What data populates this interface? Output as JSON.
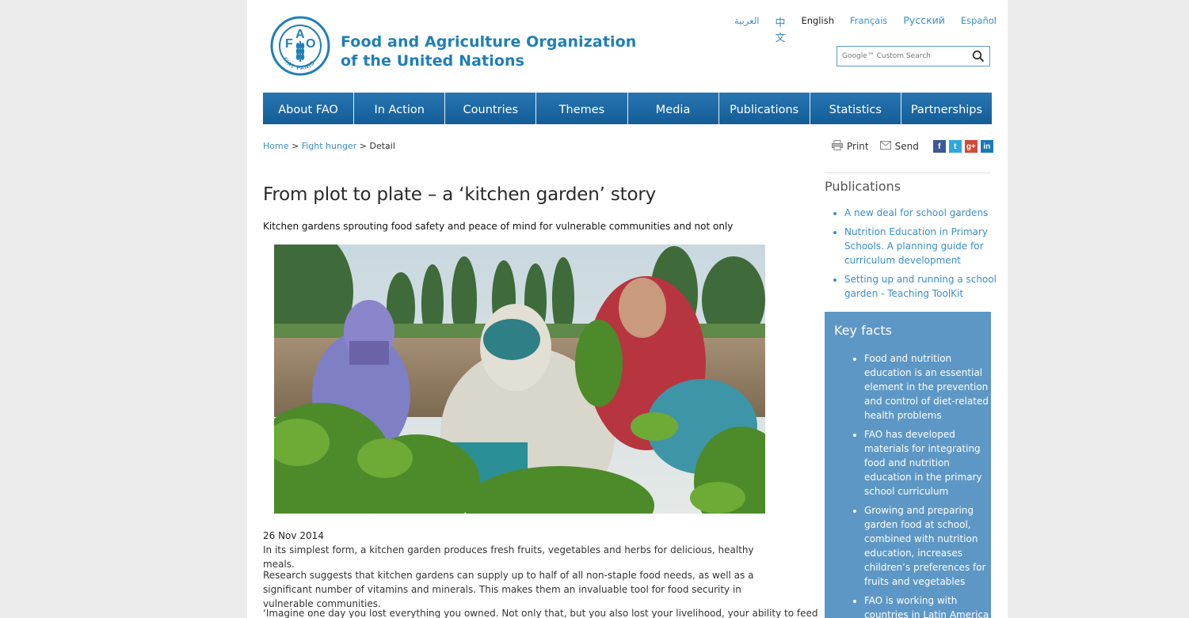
{
  "header": {
    "org_name_line1": "Food and Agriculture Organization",
    "org_name_line2": "of the United Nations",
    "logo": {
      "letters": [
        "F",
        "A",
        "O"
      ],
      "motto": "FIAT PANIS",
      "icon": "fao-logo-icon"
    }
  },
  "languages": [
    {
      "label": "العربية",
      "current": false
    },
    {
      "label": "中文",
      "current": false
    },
    {
      "label": "English",
      "current": true
    },
    {
      "label": "Français",
      "current": false
    },
    {
      "label": "Русский",
      "current": false
    },
    {
      "label": "Español",
      "current": false
    }
  ],
  "search": {
    "placeholder": "Google™ Custom Search",
    "icon": "search-icon"
  },
  "nav": [
    "About FAO",
    "In Action",
    "Countries",
    "Themes",
    "Media",
    "Publications",
    "Statistics",
    "Partnerships"
  ],
  "breadcrumb": {
    "home": "Home",
    "section": "Fight hunger",
    "current": "Detail",
    "separator": ">"
  },
  "tools": {
    "print": "Print",
    "send": "Send",
    "social": [
      {
        "name": "facebook",
        "glyph": "f",
        "color": "#3b5998"
      },
      {
        "name": "twitter",
        "glyph": "t",
        "color": "#2fa8e0"
      },
      {
        "name": "google-plus",
        "glyph": "g+",
        "color": "#d34836"
      },
      {
        "name": "linkedin",
        "glyph": "in",
        "color": "#1a7ab5"
      }
    ]
  },
  "article": {
    "title": "From plot to plate – a ‘kitchen garden’ story",
    "subtitle": "Kitchen gardens sprouting food safety and peace of mind for vulnerable communities and not only",
    "date": "26 Nov 2014",
    "paragraphs": [
      "In its simplest form, a kitchen garden produces fresh fruits, vegetables and herbs for delicious, healthy meals.",
      "Research suggests that kitchen gardens can supply up to half of all non-staple food needs, as well as a significant number of vitamins and minerals. This makes them an invaluable tool for food security in vulnerable communities.",
      "‘Imagine one day you lost everything you owned.  Not only that, but you also lost your livelihood, your ability to feed"
    ]
  },
  "sidebar": {
    "publications_heading": "Publications",
    "publications": [
      "A new deal for school gardens",
      "Nutrition Education in Primary Schools. A planning guide for curriculum development",
      "Setting up and running a school garden - Teaching ToolKit"
    ],
    "keyfacts_heading": "Key facts",
    "keyfacts": [
      "Food and nutrition education is an essential element in the prevention and control of diet-related health problems",
      "FAO has developed materials for integrating food and nutrition education in the primary school curriculum",
      "Growing and preparing garden food at school, combined with nutrition education, increases children’s preferences for fruits and vegetables",
      "FAO is working with countries in Latin America"
    ]
  },
  "colors": {
    "brand_blue": "#1f7fb7",
    "nav_blue": "#1769a7",
    "link_blue": "#3b8ec8",
    "keyfacts_bg": "#5d97c6",
    "page_bg": "#ececec"
  }
}
